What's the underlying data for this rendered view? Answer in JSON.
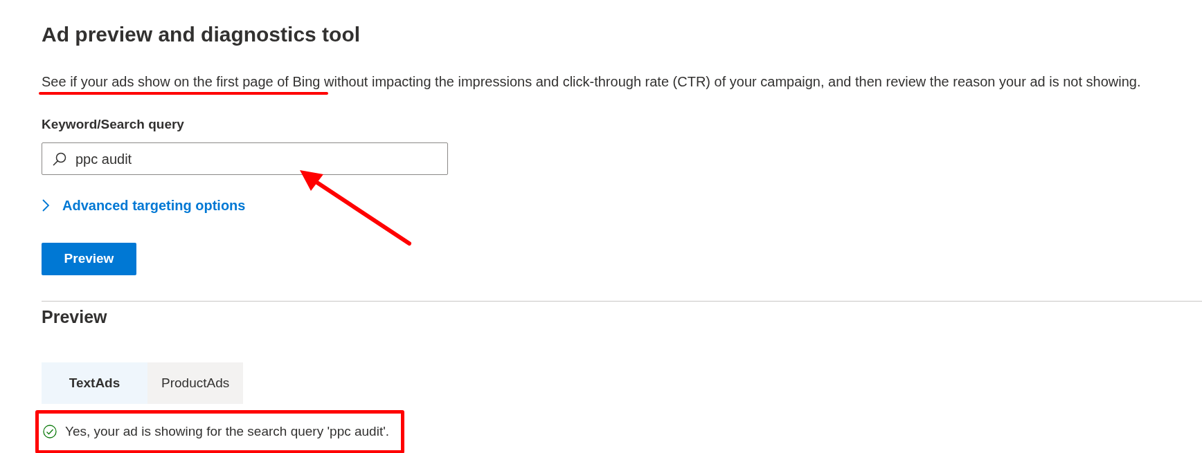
{
  "title": "Ad preview and diagnostics tool",
  "description": "See if your ads show on the first page of Bing without impacting the impressions and click-through rate (CTR) of your campaign, and then review the reason your ad is not showing.",
  "search": {
    "label": "Keyword/Search query",
    "value": "ppc audit"
  },
  "advanced_link": {
    "label": "Advanced targeting options",
    "expanded": false
  },
  "preview_button": "Preview",
  "preview_section": {
    "heading": "Preview",
    "tabs": [
      {
        "label": "TextAds",
        "selected": true
      },
      {
        "label": "ProductAds",
        "selected": false
      }
    ],
    "message": {
      "kind": "success",
      "text": "Yes, your ad is showing for the search query 'ppc audit'."
    }
  }
}
